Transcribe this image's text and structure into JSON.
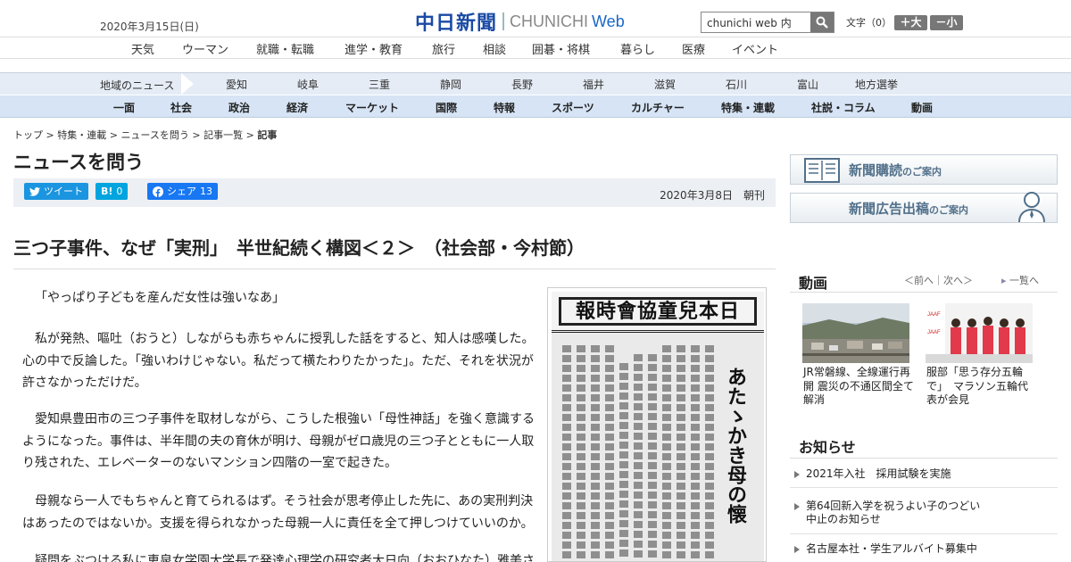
{
  "header": {
    "date": "2020年3月15日(日)",
    "logo_kanji": "中日新聞",
    "logo_en": "CHUNICHI",
    "logo_web": "Web",
    "search_placeholder": "chunichi web 内",
    "fontsize_label": "文字（0）",
    "font_plus": "＋大",
    "font_minus": "－小"
  },
  "nav_main": [
    "天気",
    "ウーマン",
    "就職・転職",
    "進学・教育",
    "旅行",
    "相談",
    "囲碁・将棋",
    "暮らし",
    "医療",
    "イベント"
  ],
  "region_nav": {
    "label": "地域のニュース",
    "items": [
      "愛知",
      "岐阜",
      "三重",
      "静岡",
      "長野",
      "福井",
      "滋賀",
      "石川",
      "富山",
      "地方選挙"
    ]
  },
  "category_nav": [
    "一面",
    "社会",
    "政治",
    "経済",
    "マーケット",
    "国際",
    "特報",
    "スポーツ",
    "カルチャー",
    "特集・連載",
    "社説・コラム",
    "動画"
  ],
  "breadcrumb": {
    "items": [
      "トップ",
      "特集・連載",
      "ニュースを問う",
      "記事一覧"
    ],
    "current": "記事",
    "sep": " > "
  },
  "section_title": "ニュースを問う",
  "share": {
    "tweet": "ツイート",
    "hatena_count": "0",
    "facebook": "シェア",
    "facebook_count": "13",
    "pub_date": "2020年3月8日",
    "edition": "朝刊"
  },
  "article": {
    "headline": "三つ子事件、なぜ「実刑」　半世紀続く構図＜２＞　（社会部・今村節）",
    "paragraphs": [
      "「やっぱり子どもを産んだ女性は強いなあ」",
      "私が発熱、嘔吐（おうと）しながらも赤ちゃんに授乳した話をすると、知人は感嘆した。心の中で反論した。「強いわけじゃない。私だって横たわりたかった」。ただ、それを状況が許さなかっただけだ。",
      "愛知県豊田市の三つ子事件を取材しながら、こうした根強い「母性神話」を強く意識するようになった。事件は、半年間の夫の育休が明け、母親がゼロ歳児の三つ子とともに一人取り残された、エレベーターのないマンション四階の一室で起きた。",
      "母親なら一人でもちゃんと育てられるはず。そう社会が思考停止した先に、あの実刑判決はあったのではないか。支援を得られなかった母親一人に責任を全て押しつけていいのか。",
      "疑問をぶつける私に恵泉女学園大学長で発達心理学の研究者大日向（おおひなた）雅美さ"
    ],
    "photo": {
      "paper_title": "報時會協童兒本日",
      "vertical_title": "あたゝかき母の懐"
    }
  },
  "sidebar": {
    "banner1": {
      "main": "新聞購読",
      "sub": "のご案内"
    },
    "banner2": {
      "main": "新聞広告出稿",
      "sub": "のご案内"
    },
    "video": {
      "title": "動画",
      "nav": "＜前へ｜次へ＞",
      "list_link": "一覧へ",
      "items": [
        {
          "caption": "JR常磐線、全線運行再開 震災の不通区間全て解消"
        },
        {
          "caption": "服部「思う存分五輪で」　マラソン五輪代表が会見"
        }
      ]
    },
    "notices": {
      "title": "お知らせ",
      "items": [
        "2021年入社　採用試験を実施",
        "第64回新入学を祝うよい子のつどい　中止のお知らせ",
        "名古屋本社・学生アルバイト募集中"
      ]
    }
  },
  "colors": {
    "brand_blue": "#1a4aa5",
    "twitter": "#1b95e0",
    "hatena": "#00a4de",
    "facebook": "#1877f2",
    "region_bg": "#e6ecf5",
    "category_bg": "#d6e4f5"
  }
}
